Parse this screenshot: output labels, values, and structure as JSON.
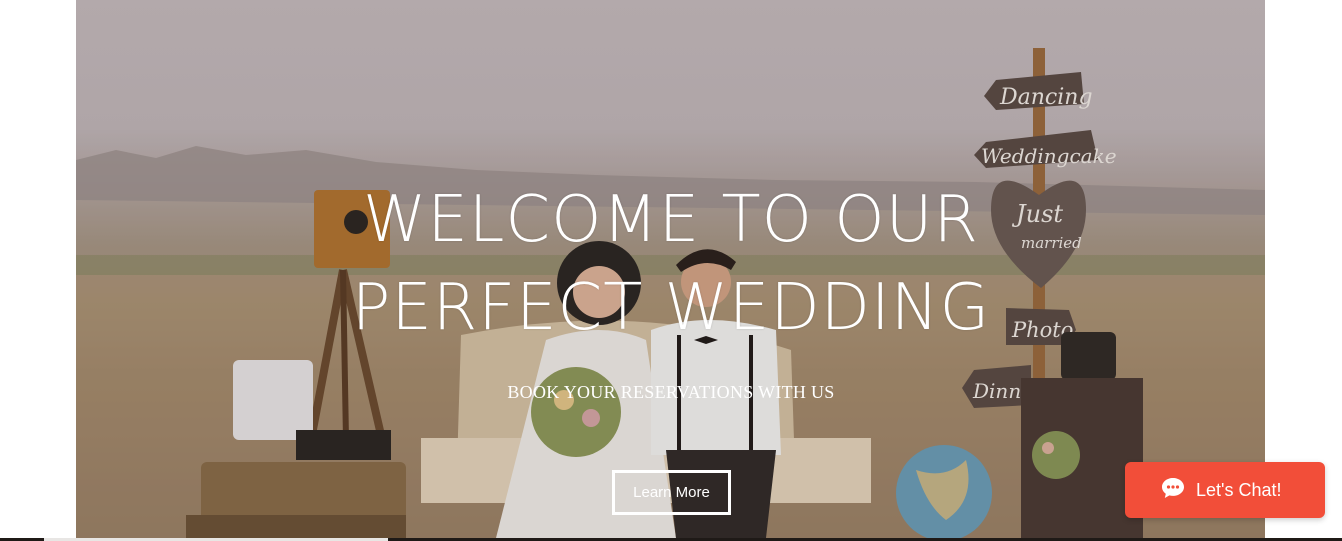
{
  "hero": {
    "title_line1": "WELCOME TO OUR",
    "title_line2": "PERFECT WEDDING",
    "subtitle": "BOOK YOUR RESERVATIONS WITH US",
    "button_label": "Learn More",
    "signs": {
      "dancing": "Dancing",
      "weddingcake": "Weddingcake",
      "just_married_1": "Just",
      "just_married_2": "married",
      "photo": "Photo",
      "dinner": "Dinner"
    }
  },
  "chat": {
    "label": "Let's Chat!",
    "icon": "chat-bubble-icon",
    "color": "#f24e39"
  },
  "colors": {
    "text": "#ffffff",
    "chat_accent": "#f24e39"
  }
}
